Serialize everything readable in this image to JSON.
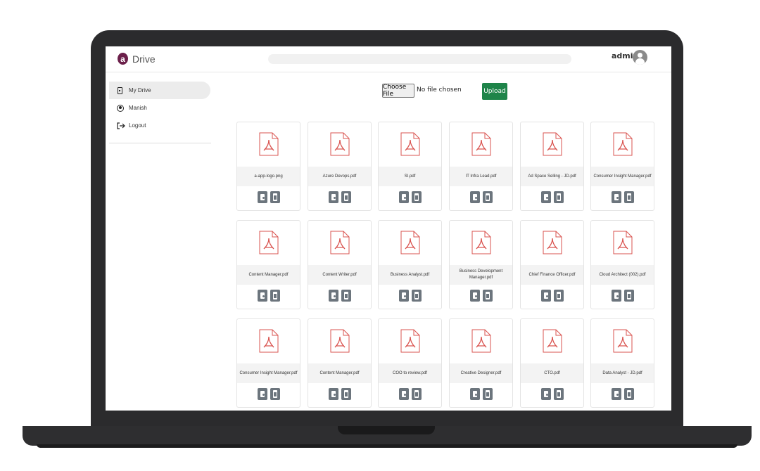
{
  "header": {
    "logo_letter": "a",
    "app_title": "Drive",
    "user_name": "admin"
  },
  "sidebar": {
    "items": [
      {
        "label": "My Drive",
        "icon": "phone-icon",
        "active": true
      },
      {
        "label": "Manish",
        "icon": "person-icon",
        "active": false
      },
      {
        "label": "Logout",
        "icon": "logout-icon",
        "active": false
      }
    ]
  },
  "upload": {
    "choose_label": "Choose File",
    "no_file_text": "No file chosen",
    "upload_label": "Upload",
    "upload_color": "#1e8449"
  },
  "files": [
    {
      "name": "a-app-logo.png",
      "icon": "pdf-file-icon"
    },
    {
      "name": "Azure Devops.pdf",
      "icon": "pdf-file-icon"
    },
    {
      "name": "SI.pdf",
      "icon": "pdf-file-icon"
    },
    {
      "name": "IT Infra Lead.pdf",
      "icon": "pdf-file-icon"
    },
    {
      "name": "Ad Space Selling - JD.pdf",
      "icon": "pdf-file-icon"
    },
    {
      "name": "Consumer Insight Manager.pdf",
      "icon": "pdf-file-icon"
    },
    {
      "name": "Content Manager.pdf",
      "icon": "pdf-file-icon"
    },
    {
      "name": "Content Writer.pdf",
      "icon": "pdf-file-icon"
    },
    {
      "name": "Business Analyst.pdf",
      "icon": "pdf-file-icon"
    },
    {
      "name": "Business Development Manager.pdf",
      "icon": "pdf-file-icon"
    },
    {
      "name": "Chief Finance Officer.pdf",
      "icon": "pdf-file-icon"
    },
    {
      "name": "Cloud Architect (002).pdf",
      "icon": "pdf-file-icon"
    },
    {
      "name": "Consumer Insight Manager.pdf",
      "icon": "pdf-file-icon"
    },
    {
      "name": "Content Manager.pdf",
      "icon": "pdf-file-icon"
    },
    {
      "name": "COO to review.pdf",
      "icon": "pdf-file-icon"
    },
    {
      "name": "Creative Designer.pdf",
      "icon": "pdf-file-icon"
    },
    {
      "name": "CTO.pdf",
      "icon": "pdf-file-icon"
    },
    {
      "name": "Data Analyst - JD.pdf",
      "icon": "pdf-file-icon"
    }
  ],
  "colors": {
    "brand": "#6b1f4a",
    "action_button": "#6c757d",
    "pdf_red": "#d9534f"
  }
}
